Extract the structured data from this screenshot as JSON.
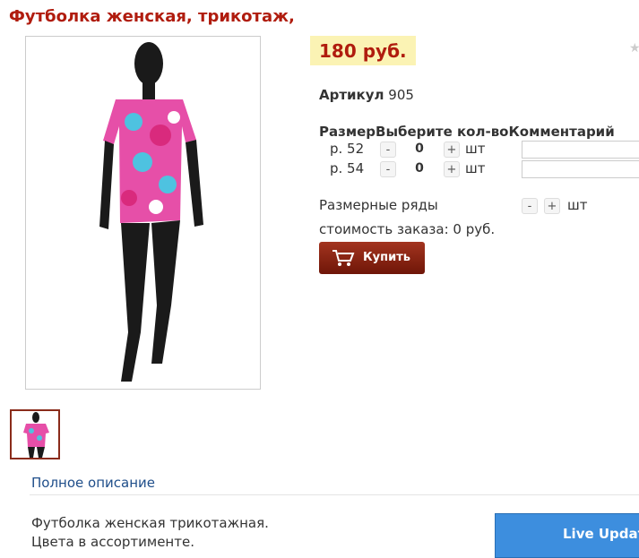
{
  "product": {
    "title": "Футболка женская, трикотаж,",
    "price": "180 руб.",
    "sku_label": "Артикул",
    "sku_value": "905"
  },
  "sizes_table": {
    "col_size": "Размер",
    "col_qty": "Выберите кол-во",
    "col_comment": "Комментарий",
    "minus": "-",
    "plus": "+",
    "unit": "шт",
    "rows": [
      {
        "size": "р. 52",
        "qty": "0"
      },
      {
        "size": "р. 54",
        "qty": "0"
      }
    ]
  },
  "size_ranges": {
    "label": "Размерные ряды",
    "minus": "-",
    "plus": "+",
    "unit": "шт"
  },
  "order": {
    "cost_text": "стоимость заказа: 0 руб.",
    "buy_label": "Купить"
  },
  "description": {
    "link_label": "Полное описание",
    "lines": [
      "Футболка женская трикотажная.",
      "Цвета в ассортименте."
    ]
  },
  "live_update": {
    "label": "Live Update"
  },
  "colors": {
    "title": "#b01c0e",
    "price_bg": "#fbf3b4",
    "buy_button": "#8b2a14",
    "link": "#1f4e8a",
    "live_update": "#3d8ede"
  },
  "icons": [
    "star-icon",
    "cart-icon"
  ]
}
